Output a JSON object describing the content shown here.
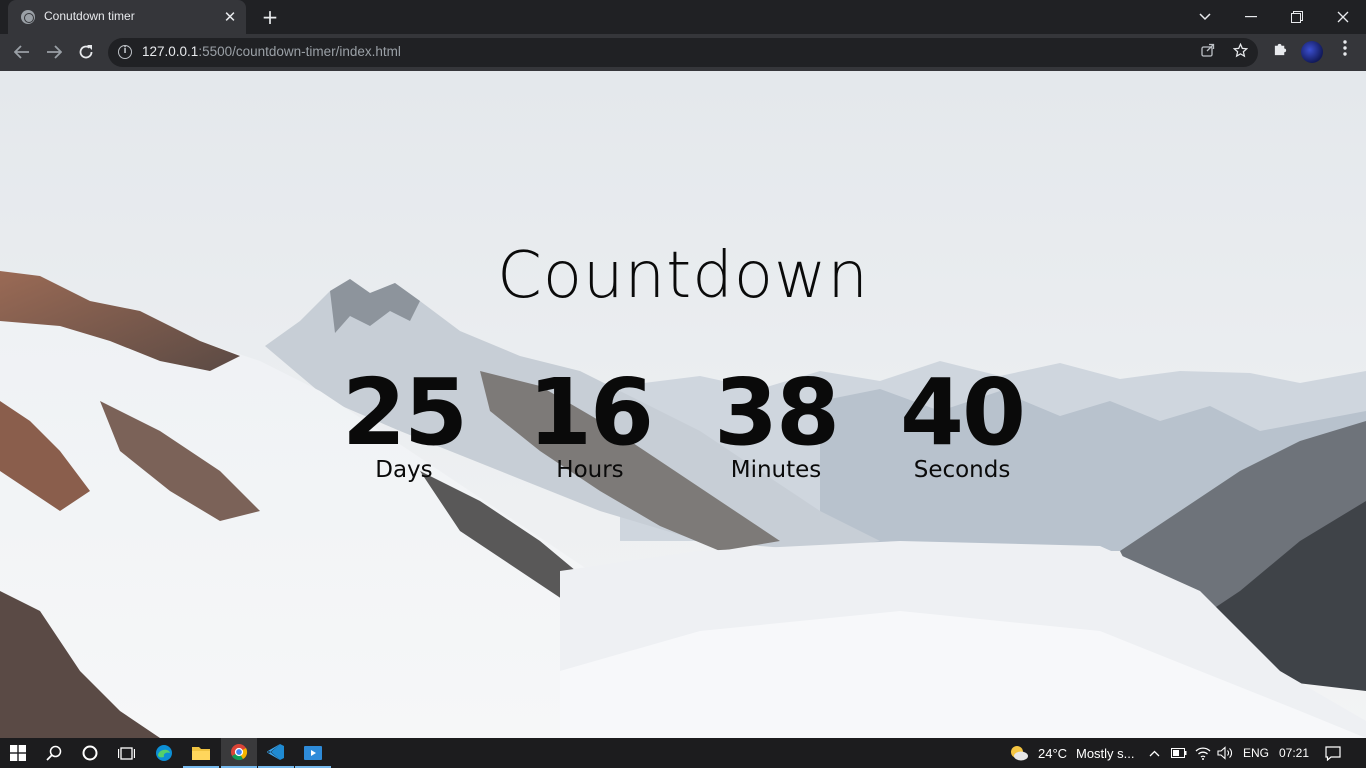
{
  "browser": {
    "tab_title": "Conutdown timer",
    "url_host": "127.0.0.1",
    "url_path": ":5500/countdown-timer/index.html"
  },
  "page": {
    "heading": "Countdown",
    "countdown": [
      {
        "value": "25",
        "label": "Days"
      },
      {
        "value": "16",
        "label": "Hours"
      },
      {
        "value": "38",
        "label": "Minutes"
      },
      {
        "value": "40",
        "label": "Seconds"
      }
    ]
  },
  "taskbar": {
    "weather_temp": "24°C",
    "weather_text": "Mostly s...",
    "language": "ENG",
    "time": "07:21"
  },
  "colors": {
    "chrome_dark": "#202124",
    "chrome_toolbar": "#35363a",
    "text_dark": "#0a0a0a",
    "taskbar_bg": "#1c1c1e",
    "taskbar_accent": "#76b9ed"
  },
  "icons": [
    "globe-icon",
    "close-icon",
    "plus-icon",
    "chevron-down-icon",
    "minimize-icon",
    "restore-icon",
    "back-icon",
    "forward-icon",
    "reload-icon",
    "info-icon",
    "share-icon",
    "star-icon",
    "puzzle-icon",
    "menu-kebab-icon",
    "windows-start-icon",
    "search-icon",
    "cortana-icon",
    "task-view-icon",
    "edge-icon",
    "file-explorer-icon",
    "chrome-icon",
    "vscode-icon",
    "media-app-icon",
    "weather-icon",
    "chevron-up-icon",
    "battery-icon",
    "wifi-icon",
    "volume-icon",
    "notification-icon"
  ]
}
